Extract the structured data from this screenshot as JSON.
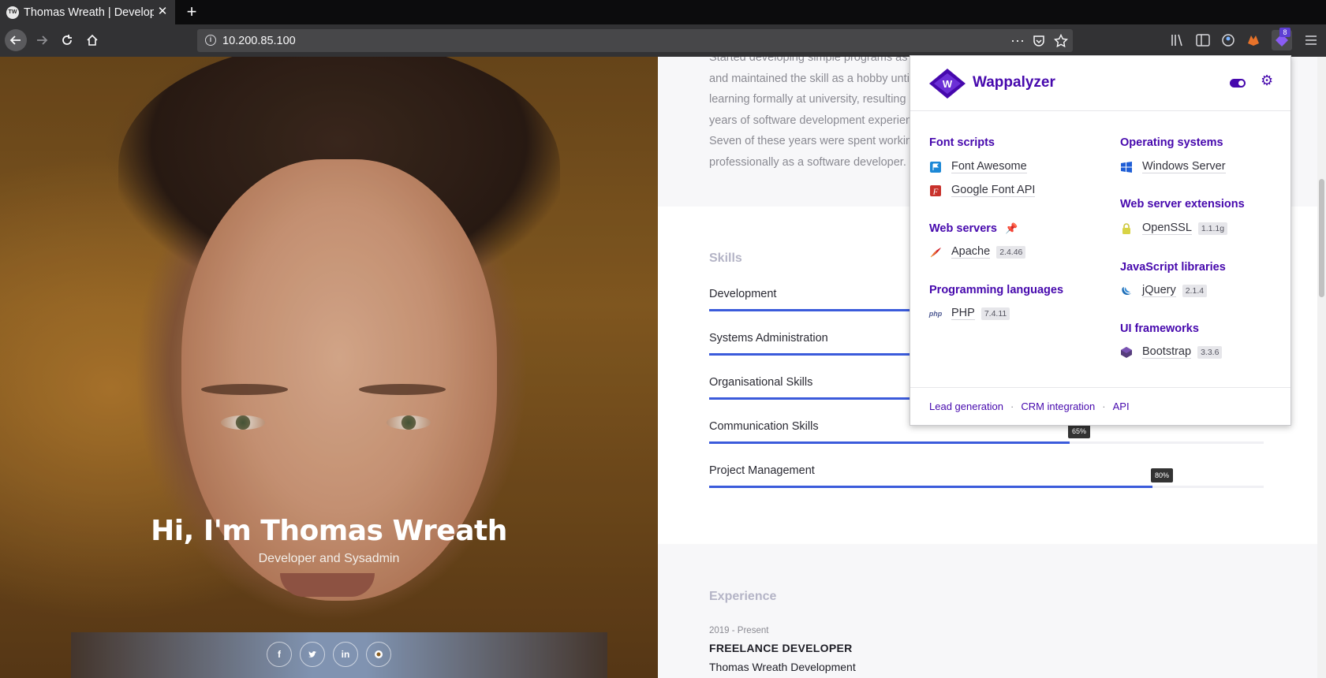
{
  "browser": {
    "tab_title": "Thomas Wreath | Developer",
    "favicon_text": "TW",
    "url": "10.200.85.100",
    "extension_badge": "8"
  },
  "hero": {
    "name": "Hi, I'm Thomas Wreath",
    "subtitle": "Developer and Sysadmin",
    "social": [
      "f",
      "t",
      "in",
      "gh"
    ]
  },
  "about": {
    "text": "Started developing simple programs as a child and maintained the skill as a hobby until learning formally at university, resulting in 25 years of software development experience. Seven of these years were spent working professionally as a software developer."
  },
  "skills": {
    "title": "Skills",
    "items": [
      {
        "label": "Development",
        "value": 90,
        "tip": ""
      },
      {
        "label": "Systems Administration",
        "value": 90,
        "tip": ""
      },
      {
        "label": "Organisational Skills",
        "value": 80,
        "tip": ""
      },
      {
        "label": "Communication Skills",
        "value": 65,
        "tip": "65%"
      },
      {
        "label": "Project Management",
        "value": 80,
        "tip": "80%"
      }
    ]
  },
  "experience": {
    "title": "Experience",
    "date": "2019 - Present",
    "role": "FREELANCE DEVELOPER",
    "company": "Thomas Wreath Development"
  },
  "wappalyzer": {
    "brand": "Wappalyzer",
    "categories": {
      "font_scripts": "Font scripts",
      "web_servers": "Web servers",
      "programming_languages": "Programming languages",
      "operating_systems": "Operating systems",
      "web_server_extensions": "Web server extensions",
      "javascript_libraries": "JavaScript libraries",
      "ui_frameworks": "UI frameworks"
    },
    "tech": {
      "font_awesome": {
        "name": "Font Awesome",
        "icon": "flag-icon"
      },
      "google_font_api": {
        "name": "Google Font API",
        "icon": "font-f-icon"
      },
      "apache": {
        "name": "Apache",
        "version": "2.4.46",
        "icon": "feather-icon"
      },
      "php": {
        "name": "PHP",
        "version": "7.4.11",
        "icon": "php-icon",
        "icon_text": "php"
      },
      "windows_server": {
        "name": "Windows Server",
        "icon": "windows-icon"
      },
      "openssl": {
        "name": "OpenSSL",
        "version": "1.1.1g",
        "icon": "lock-icon"
      },
      "jquery": {
        "name": "jQuery",
        "version": "2.1.4",
        "icon": "jquery-icon"
      },
      "bootstrap": {
        "name": "Bootstrap",
        "version": "3.3.6",
        "icon": "bootstrap-icon"
      }
    },
    "footer": {
      "lead_generation": "Lead generation",
      "crm_integration": "CRM integration",
      "api": "API",
      "separator": "·"
    }
  },
  "colors": {
    "wappalyzer_purple": "#4608ad",
    "skill_bar_blue": "#3b5bdb",
    "browser_dark": "#323234"
  }
}
